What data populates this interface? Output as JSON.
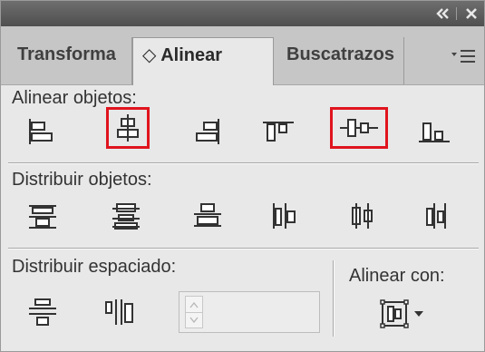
{
  "titlebar": {
    "collapse_icon": "double-chevron-left-icon",
    "close_icon": "close-icon"
  },
  "tabs": [
    {
      "label": "Transforma",
      "active": false
    },
    {
      "label": "◇ Alinear",
      "active": true
    },
    {
      "label": "Buscatrazos",
      "active": false
    }
  ],
  "panel_menu_icon": "panel-menu-icon",
  "align_objects": {
    "label": "Alinear objetos:",
    "buttons": [
      {
        "name": "align-left-icon",
        "highlighted": false
      },
      {
        "name": "align-horizontal-center-icon",
        "highlighted": true
      },
      {
        "name": "align-right-icon",
        "highlighted": false
      },
      {
        "name": "align-top-icon",
        "highlighted": false
      },
      {
        "name": "align-vertical-center-icon",
        "highlighted": true
      },
      {
        "name": "align-bottom-icon",
        "highlighted": false
      }
    ]
  },
  "distribute_objects": {
    "label": "Distribuir objetos:",
    "buttons": [
      {
        "name": "distribute-top-icon"
      },
      {
        "name": "distribute-vertical-center-icon"
      },
      {
        "name": "distribute-bottom-icon"
      },
      {
        "name": "distribute-left-icon"
      },
      {
        "name": "distribute-horizontal-center-icon"
      },
      {
        "name": "distribute-right-icon"
      }
    ]
  },
  "distribute_spacing": {
    "label": "Distribuir espaciado:",
    "buttons": [
      {
        "name": "distribute-vertical-space-icon"
      },
      {
        "name": "distribute-horizontal-space-icon"
      }
    ],
    "spacing_value": "",
    "disabled": true
  },
  "align_to": {
    "label": "Alinear con:",
    "icon": "align-to-selection-icon",
    "dropdown_icon": "dropdown-triangle-icon"
  },
  "colors": {
    "titlebar": "#5a5a5a",
    "tab_inactive": "#c6c6c6",
    "panel_bg": "#e8e8e8",
    "highlight": "#e0141e"
  }
}
